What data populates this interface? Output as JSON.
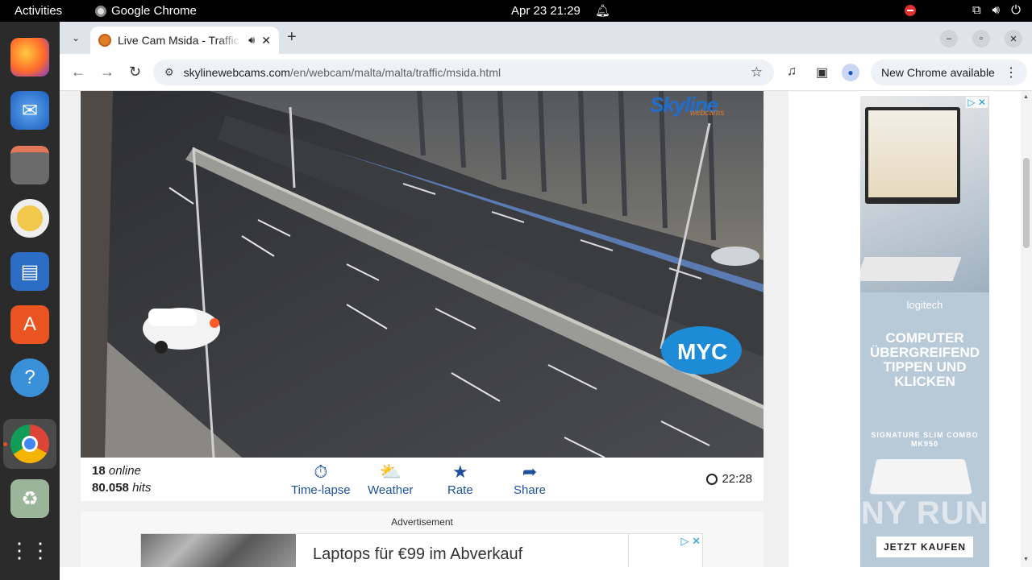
{
  "topbar": {
    "activities": "Activities",
    "app_name": "Google Chrome",
    "clock": "Apr 23  21:29"
  },
  "dock": {
    "items": [
      "Firefox",
      "Thunderbird",
      "Files",
      "Rhythmbox",
      "LibreOffice Writer",
      "Ubuntu Software",
      "Help",
      "Google Chrome",
      "Trash",
      "Show Applications"
    ]
  },
  "browser": {
    "tab_title": "Live Cam Msida - Traffic",
    "url_host": "skylinewebcams.com",
    "url_path": "/en/webcam/malta/malta/traffic/msida.html",
    "update_label": "New Chrome available"
  },
  "webcam": {
    "brand": "Skyline",
    "brand_sub": "webcams",
    "overlay_logo": "MYC",
    "online_count": "18",
    "online_label": "online",
    "hits_count": "80.058",
    "hits_label": "hits",
    "actions": [
      {
        "label": "Time-lapse",
        "icon": "timelapse-icon"
      },
      {
        "label": "Weather",
        "icon": "weather-icon"
      },
      {
        "label": "Rate",
        "icon": "star-icon"
      },
      {
        "label": "Share",
        "icon": "share-icon"
      }
    ],
    "local_time": "22:28"
  },
  "ads": {
    "label": "Advertisement",
    "banner_text": "Laptops für €99 im Abverkauf",
    "side": {
      "brand": "logitech",
      "headline": "COMPUTER ÜBERGREIFEND TIPPEN UND KLICKEN",
      "product": "SIGNATURE SLIM COMBO MK950",
      "cta": "JETZT KAUFEN"
    }
  },
  "watermark": "ANY RUN",
  "colors": {
    "accent": "#1e4f9c",
    "dock_bg": "#2b2b2b",
    "topbar_bg": "#000000"
  }
}
